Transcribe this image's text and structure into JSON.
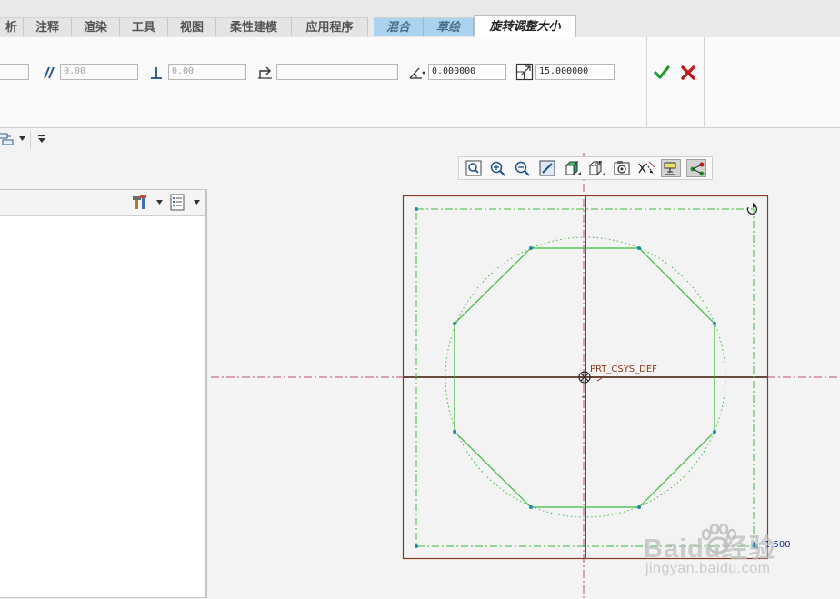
{
  "tabs": [
    {
      "label": "析"
    },
    {
      "label": "注释"
    },
    {
      "label": "渲染"
    },
    {
      "label": "工具"
    },
    {
      "label": "视图"
    },
    {
      "label": "柔性建模"
    },
    {
      "label": "应用程序"
    },
    {
      "label": "混合"
    },
    {
      "label": "草绘"
    },
    {
      "label": "旋转调整大小"
    }
  ],
  "dashboard": {
    "parallel_value": "0.00",
    "perpendicular_value": "0.00",
    "reference_value": "",
    "rotation_value": "0.000000",
    "scale_value": "15.000000"
  },
  "sketch": {
    "csys_label": "PRT_CSYS_DEF",
    "dimension_label": "1.500"
  },
  "watermark": {
    "brand": "Baidu经验",
    "url": "jingyan.baidu.com"
  },
  "colors": {
    "accept": "#1e9a2e",
    "cancel": "#c21818",
    "sketch_green": "#3dbb3d",
    "frame_brown": "#8a3b1a",
    "context_tab": "#a9d3ef"
  },
  "icons": {
    "accept": "check-icon",
    "cancel": "close-icon"
  }
}
